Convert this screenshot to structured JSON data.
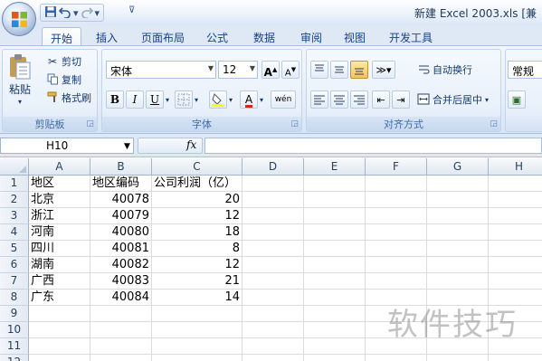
{
  "window": {
    "title": "新建 Excel 2003.xls",
    "title_tail": "[兼"
  },
  "quick_access": {
    "save_icon": "save-icon",
    "undo_icon": "undo-icon",
    "redo_icon": "redo-icon",
    "customize_icon": "customize-qat-icon"
  },
  "tabs": [
    {
      "label": "开始",
      "active": true
    },
    {
      "label": "插入"
    },
    {
      "label": "页面布局"
    },
    {
      "label": "公式"
    },
    {
      "label": "数据"
    },
    {
      "label": "审阅"
    },
    {
      "label": "视图"
    },
    {
      "label": "开发工具"
    }
  ],
  "ribbon": {
    "clipboard": {
      "label": "剪贴板",
      "paste": "粘贴",
      "cut": "剪切",
      "copy": "复制",
      "format_painter": "格式刷"
    },
    "font": {
      "label": "字体",
      "font_name": "宋体",
      "font_size": "12",
      "bold": "B",
      "italic": "I",
      "underline": "U",
      "grow": "A",
      "shrink": "A",
      "wen": "wén"
    },
    "alignment": {
      "label": "对齐方式",
      "wrap_text": "自动换行",
      "merge_center": "合并后居中"
    },
    "number": {
      "format": "常规"
    }
  },
  "formula_bar": {
    "name_box": "H10",
    "fx": "fx",
    "value": ""
  },
  "columns": [
    "A",
    "B",
    "C",
    "D",
    "E",
    "F",
    "G",
    "H"
  ],
  "rows": [
    "1",
    "2",
    "3",
    "4",
    "5",
    "6",
    "7",
    "8",
    "9",
    "10",
    "11",
    "12"
  ],
  "table": {
    "header": [
      "地区",
      "地区编码",
      "公司利润（亿）"
    ],
    "body": [
      [
        "北京",
        "40078",
        "20"
      ],
      [
        "浙江",
        "40079",
        "12"
      ],
      [
        "河南",
        "40080",
        "18"
      ],
      [
        "四川",
        "40081",
        "8"
      ],
      [
        "湖南",
        "40082",
        "12"
      ],
      [
        "广西",
        "40083",
        "21"
      ],
      [
        "广东",
        "40084",
        "14"
      ]
    ]
  },
  "watermark": "软件技巧"
}
